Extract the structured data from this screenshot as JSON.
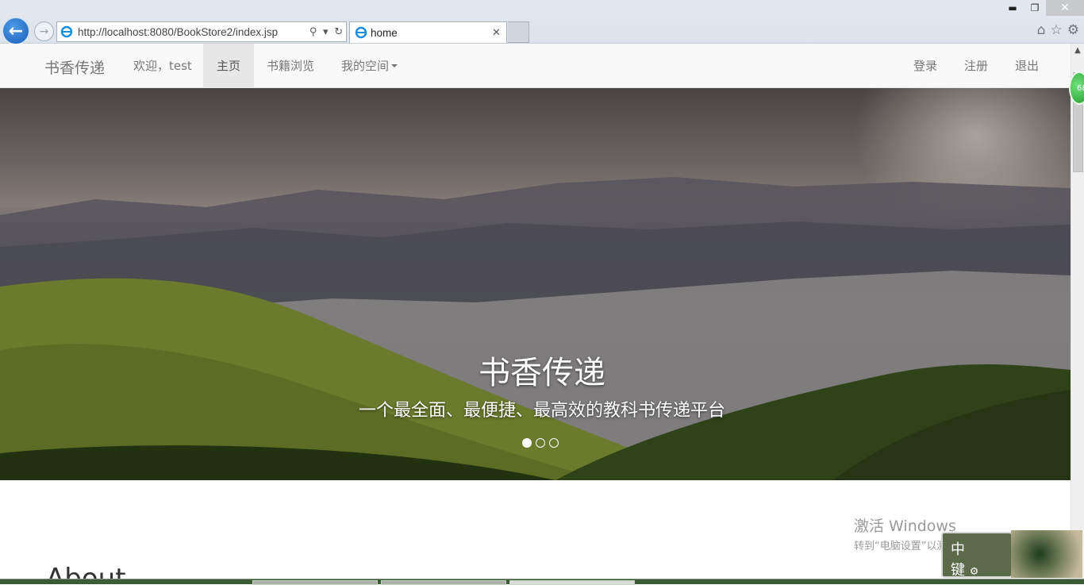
{
  "browser": {
    "address_url": "http://localhost:8080/BookStore2/index.jsp",
    "tab_title": "home",
    "icons": [
      "back-icon",
      "forward-icon",
      "search-icon",
      "dropdown-icon",
      "refresh-icon",
      "close-icon",
      "home-icon",
      "favorites-star-icon",
      "settings-gear-icon"
    ]
  },
  "navbar": {
    "brand": "书香传递",
    "welcome": "欢迎，test",
    "items": [
      "主页",
      "书籍浏览",
      "我的空间"
    ],
    "active_index": 0,
    "right_items": [
      "登录",
      "注册",
      "退出"
    ]
  },
  "hero": {
    "title": "书香传递",
    "subtitle": "一个最全面、最便捷、最高效的教科书传递平台",
    "slide_count": 3,
    "active_slide": 0
  },
  "about_heading": "About",
  "activation": {
    "line1": "激活 Windows",
    "line2": "转到“电脑设置”以激活 Windows。"
  },
  "ime": {
    "label1": "中",
    "label2": "键"
  },
  "side_badge": "68"
}
